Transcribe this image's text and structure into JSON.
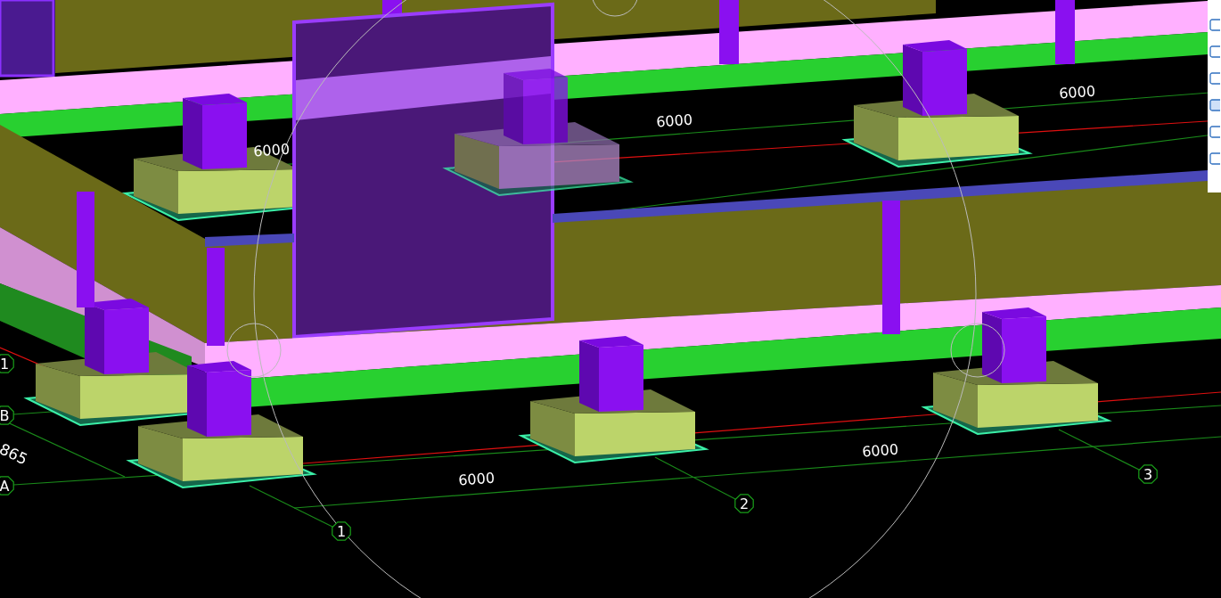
{
  "viewport": {
    "dimension_labels": [
      "6000",
      "6000",
      "6000",
      "6000",
      "6000"
    ],
    "grid_bubbles": [
      "1",
      "B",
      "3",
      "A",
      "2",
      "1"
    ],
    "cut_dimension": "865"
  }
}
